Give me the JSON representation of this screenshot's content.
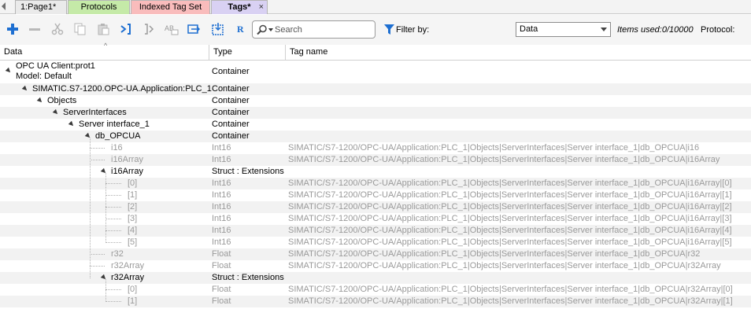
{
  "tabs": [
    {
      "label": "1:Page1*"
    },
    {
      "label": "Protocols"
    },
    {
      "label": "Indexed Tag Set"
    },
    {
      "label": "Tags*",
      "close": "×"
    }
  ],
  "toolbar": {
    "search_placeholder": "Search",
    "filter_label": "Filter by:",
    "filter_value": "Data",
    "items_used": "Items used:0/10000",
    "protocol_label": "Protocol:",
    "icons": [
      "add-icon",
      "remove-icon",
      "cut-icon",
      "copy-icon",
      "paste-icon",
      "map-tag-icon",
      "unmap-tag-icon",
      "rename-icon",
      "convert-icon",
      "export-icon",
      "rebrowse-icon"
    ],
    "rebrowse_glyph": "R",
    "rename_glyph": "AB"
  },
  "columns": {
    "data": "Data",
    "type": "Type",
    "tag_name": "Tag name",
    "sort_glyph": "^"
  },
  "rows": [
    {
      "data_line1": "OPC UA Client:prot1",
      "data_line2": "Model: Default",
      "type": "Container",
      "tag": "",
      "level": 0,
      "expander": true,
      "dim": false
    },
    {
      "data": "SIMATIC.S7-1200.OPC-UA.Application:PLC_1",
      "type": "Container",
      "tag": "",
      "level": 1,
      "expander": true,
      "dim": false
    },
    {
      "data": "Objects",
      "type": "Container",
      "tag": "",
      "level": 2,
      "expander": true,
      "dim": false
    },
    {
      "data": "ServerInterfaces",
      "type": "Container",
      "tag": "",
      "level": 3,
      "expander": true,
      "dim": false
    },
    {
      "data": "Server interface_1",
      "type": "Container",
      "tag": "",
      "level": 4,
      "expander": true,
      "dim": false
    },
    {
      "data": "db_OPCUA",
      "type": "Container",
      "tag": "",
      "level": 5,
      "expander": true,
      "dim": false
    },
    {
      "data": "i16",
      "type": "Int16",
      "tag": "SIMATIC/S7-1200/OPC-UA/Application:PLC_1|Objects|ServerInterfaces|Server interface_1|db_OPCUA|i16",
      "level": 6,
      "expander": false,
      "dim": true
    },
    {
      "data": "i16Array",
      "type": "Int16",
      "tag": "SIMATIC/S7-1200/OPC-UA/Application:PLC_1|Objects|ServerInterfaces|Server interface_1|db_OPCUA|i16Array",
      "level": 6,
      "expander": false,
      "dim": true
    },
    {
      "data": "i16Array",
      "type": "Struct : Extensions",
      "tag": "",
      "level": 6,
      "expander": true,
      "dim": false
    },
    {
      "data": "[0]",
      "type": "Int16",
      "tag": "SIMATIC/S7-1200/OPC-UA/Application:PLC_1|Objects|ServerInterfaces|Server interface_1|db_OPCUA|i16Array|[0]",
      "level": 7,
      "expander": false,
      "dim": true
    },
    {
      "data": "[1]",
      "type": "Int16",
      "tag": "SIMATIC/S7-1200/OPC-UA/Application:PLC_1|Objects|ServerInterfaces|Server interface_1|db_OPCUA|i16Array|[1]",
      "level": 7,
      "expander": false,
      "dim": true
    },
    {
      "data": "[2]",
      "type": "Int16",
      "tag": "SIMATIC/S7-1200/OPC-UA/Application:PLC_1|Objects|ServerInterfaces|Server interface_1|db_OPCUA|i16Array|[2]",
      "level": 7,
      "expander": false,
      "dim": true
    },
    {
      "data": "[3]",
      "type": "Int16",
      "tag": "SIMATIC/S7-1200/OPC-UA/Application:PLC_1|Objects|ServerInterfaces|Server interface_1|db_OPCUA|i16Array|[3]",
      "level": 7,
      "expander": false,
      "dim": true
    },
    {
      "data": "[4]",
      "type": "Int16",
      "tag": "SIMATIC/S7-1200/OPC-UA/Application:PLC_1|Objects|ServerInterfaces|Server interface_1|db_OPCUA|i16Array|[4]",
      "level": 7,
      "expander": false,
      "dim": true
    },
    {
      "data": "[5]",
      "type": "Int16",
      "tag": "SIMATIC/S7-1200/OPC-UA/Application:PLC_1|Objects|ServerInterfaces|Server interface_1|db_OPCUA|i16Array|[5]",
      "level": 7,
      "expander": false,
      "dim": true
    },
    {
      "data": "r32",
      "type": "Float",
      "tag": "SIMATIC/S7-1200/OPC-UA/Application:PLC_1|Objects|ServerInterfaces|Server interface_1|db_OPCUA|r32",
      "level": 6,
      "expander": false,
      "dim": true
    },
    {
      "data": "r32Array",
      "type": "Float",
      "tag": "SIMATIC/S7-1200/OPC-UA/Application:PLC_1|Objects|ServerInterfaces|Server interface_1|db_OPCUA|r32Array",
      "level": 6,
      "expander": false,
      "dim": true
    },
    {
      "data": "r32Array",
      "type": "Struct : Extensions",
      "tag": "",
      "level": 6,
      "expander": true,
      "dim": false
    },
    {
      "data": "[0]",
      "type": "Float",
      "tag": "SIMATIC/S7-1200/OPC-UA/Application:PLC_1|Objects|ServerInterfaces|Server interface_1|db_OPCUA|r32Array|[0]",
      "level": 7,
      "expander": false,
      "dim": true
    },
    {
      "data": "[1]",
      "type": "Float",
      "tag": "SIMATIC/S7-1200/OPC-UA/Application:PLC_1|Objects|ServerInterfaces|Server interface_1|db_OPCUA|r32Array|[1]",
      "level": 7,
      "expander": false,
      "dim": true
    }
  ]
}
